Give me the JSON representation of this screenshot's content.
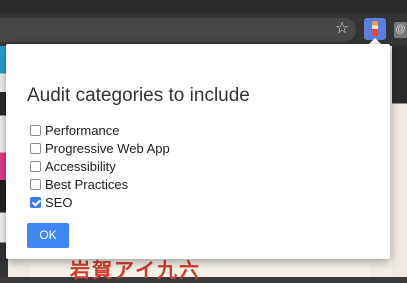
{
  "browser": {
    "star_icon": "☆",
    "extension_icon": "lighthouse-icon"
  },
  "popup": {
    "title": "Audit categories to include",
    "options": [
      {
        "label": "Performance",
        "checked": false
      },
      {
        "label": "Progressive Web App",
        "checked": false
      },
      {
        "label": "Accessibility",
        "checked": false
      },
      {
        "label": "Best Practices",
        "checked": false
      },
      {
        "label": "SEO",
        "checked": true
      }
    ],
    "ok_label": "OK"
  },
  "colors": {
    "accent": "#3f87f5",
    "checkbox_checked": "#3b7be8"
  }
}
